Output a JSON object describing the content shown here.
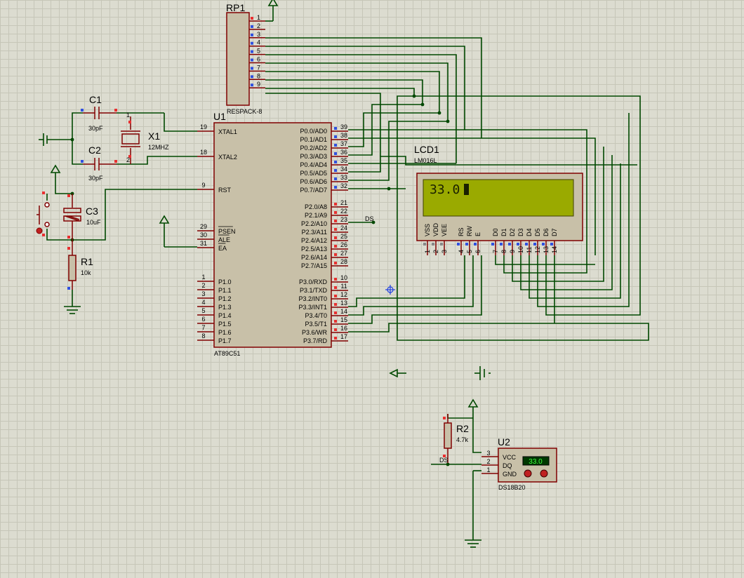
{
  "components": {
    "rp1": {
      "ref": "RP1",
      "value": "RESPACK-8",
      "pins": [
        "1",
        "2",
        "3",
        "4",
        "5",
        "6",
        "7",
        "8",
        "9"
      ]
    },
    "u1": {
      "ref": "U1",
      "value": "AT89C51",
      "left_pins": [
        {
          "num": "19",
          "name": "XTAL1"
        },
        {
          "num": "18",
          "name": "XTAL2"
        },
        {
          "num": "9",
          "name": "RST"
        },
        {
          "num": "29",
          "name": "PSEN"
        },
        {
          "num": "30",
          "name": "ALE"
        },
        {
          "num": "31",
          "name": "EA"
        },
        {
          "num": "1",
          "name": "P1.0"
        },
        {
          "num": "2",
          "name": "P1.1"
        },
        {
          "num": "3",
          "name": "P1.2"
        },
        {
          "num": "4",
          "name": "P1.3"
        },
        {
          "num": "5",
          "name": "P1.4"
        },
        {
          "num": "6",
          "name": "P1.5"
        },
        {
          "num": "7",
          "name": "P1.6"
        },
        {
          "num": "8",
          "name": "P1.7"
        }
      ],
      "right_pins": [
        {
          "num": "39",
          "name": "P0.0/AD0"
        },
        {
          "num": "38",
          "name": "P0.1/AD1"
        },
        {
          "num": "37",
          "name": "P0.2/AD2"
        },
        {
          "num": "36",
          "name": "P0.3/AD3"
        },
        {
          "num": "35",
          "name": "P0.4/AD4"
        },
        {
          "num": "34",
          "name": "P0.5/AD5"
        },
        {
          "num": "33",
          "name": "P0.6/AD6"
        },
        {
          "num": "32",
          "name": "P0.7/AD7"
        },
        {
          "num": "21",
          "name": "P2.0/A8"
        },
        {
          "num": "22",
          "name": "P2.1/A9"
        },
        {
          "num": "23",
          "name": "P2.2/A10"
        },
        {
          "num": "24",
          "name": "P2.3/A11"
        },
        {
          "num": "25",
          "name": "P2.4/A12"
        },
        {
          "num": "26",
          "name": "P2.5/A13"
        },
        {
          "num": "27",
          "name": "P2.6/A14"
        },
        {
          "num": "28",
          "name": "P2.7/A15"
        },
        {
          "num": "10",
          "name": "P3.0/RXD"
        },
        {
          "num": "11",
          "name": "P3.1/TXD"
        },
        {
          "num": "12",
          "name": "P3.2/INT0"
        },
        {
          "num": "13",
          "name": "P3.3/INT1"
        },
        {
          "num": "14",
          "name": "P3.4/T0"
        },
        {
          "num": "15",
          "name": "P3.5/T1"
        },
        {
          "num": "16",
          "name": "P3.6/WR"
        },
        {
          "num": "17",
          "name": "P3.7/RD"
        }
      ]
    },
    "c1": {
      "ref": "C1",
      "value": "30pF"
    },
    "c2": {
      "ref": "C2",
      "value": "30pF"
    },
    "x1": {
      "ref": "X1",
      "value": "12MHZ"
    },
    "c3": {
      "ref": "C3",
      "value": "10uF"
    },
    "r1": {
      "ref": "R1",
      "value": "10k"
    },
    "r2": {
      "ref": "R2",
      "value": "4.7k"
    },
    "lcd1": {
      "ref": "LCD1",
      "value": "LM016L",
      "display_text": "33.0",
      "pin_names": [
        "VSS",
        "VDD",
        "VEE",
        "RS",
        "RW",
        "E",
        "D0",
        "D1",
        "D2",
        "D3",
        "D4",
        "D5",
        "D6",
        "D7"
      ],
      "pin_nums": [
        "1",
        "2",
        "3",
        "4",
        "5",
        "6",
        "7",
        "8",
        "9",
        "10",
        "11",
        "12",
        "13",
        "14"
      ]
    },
    "u2": {
      "ref": "U2",
      "value": "DS18B20",
      "pins": [
        {
          "num": "3",
          "name": "VCC"
        },
        {
          "num": "2",
          "name": "DQ"
        },
        {
          "num": "1",
          "name": "GND"
        }
      ],
      "reading": "33.0"
    }
  },
  "net_labels": {
    "ds_p22": "DS",
    "ds_sensor": "DS"
  },
  "colors": {
    "wire": "#004800",
    "component_outline": "#800000",
    "component_fill": "#c8c0a8",
    "lcd_screen": "#9aaa00",
    "pin_red": "#e83030",
    "pin_blue": "#3050e0"
  },
  "icons": [
    "power-arrow-icon",
    "ground-icon",
    "crosshair-cursor-icon",
    "battery-icon",
    "probe-arrow-icon"
  ]
}
